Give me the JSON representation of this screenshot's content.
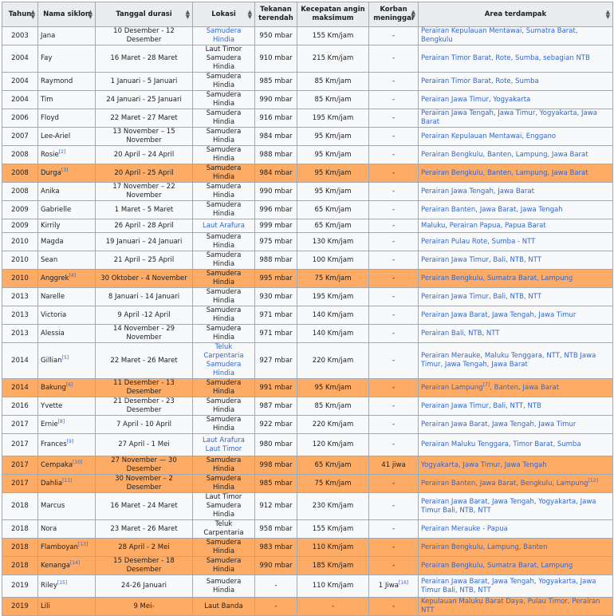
{
  "headers": {
    "tahun": "Tahun",
    "nama": "Nama siklon",
    "tanggal": "Tanggal durasi",
    "lokasi": "Lokasi",
    "tekanan": "Tekanan terendah",
    "kecepatan": "Kecepatan angin maksimum",
    "korban": "Korban meninggal",
    "area": "Area terdampak"
  },
  "sort_icon": "sort-icon",
  "colors": {
    "highlight": "#fdab65",
    "link": "#3366cc",
    "header_bg": "#eaecf0",
    "row_bg": "#f8f9fa",
    "border": "#a2a9b1"
  },
  "rows": [
    {
      "year": "2003",
      "name": "Jana",
      "sup": "",
      "date": "10 Desember - 12 Desember",
      "loc": [
        "Samudera Hindia"
      ],
      "loc_link": true,
      "pressure": "950 mbar",
      "wind": "155 Km/jam",
      "deaths": "-",
      "deaths_sup": "",
      "area": "Perairan Kepulauan Mentawai, Sumatra Barat, Bengkulu",
      "area_sup": "",
      "hl": false
    },
    {
      "year": "2004",
      "name": "Fay",
      "sup": "",
      "date": "16 Maret - 28 Maret",
      "loc": [
        "Laut Timor",
        "Samudera Hindia"
      ],
      "loc_link": false,
      "pressure": "910 mbar",
      "wind": "215 Km/jam",
      "deaths": "-",
      "deaths_sup": "",
      "area": "Perairan Timor Barat, Rote, Sumba, sebagian NTB",
      "area_sup": "",
      "hl": false
    },
    {
      "year": "2004",
      "name": "Raymond",
      "sup": "",
      "date": "1 Januari - 5 Januari",
      "loc": [
        "Samudera Hindia"
      ],
      "loc_link": false,
      "pressure": "985 mbar",
      "wind": "85 Km/jam",
      "deaths": "-",
      "deaths_sup": "",
      "area": "Perairan Timor Barat, Rote, Sumba",
      "area_sup": "",
      "hl": false
    },
    {
      "year": "2004",
      "name": "Tim",
      "sup": "",
      "date": "24 Januari - 25 Januari",
      "loc": [
        "Samudera Hindia"
      ],
      "loc_link": false,
      "pressure": "990 mbar",
      "wind": "85 Km/jam",
      "deaths": "-",
      "deaths_sup": "",
      "area": "Perairan Jawa Timur, Yogyakarta",
      "area_sup": "",
      "hl": false
    },
    {
      "year": "2006",
      "name": "Floyd",
      "sup": "",
      "date": "22 Maret - 27 Maret",
      "loc": [
        "Samudera Hindia"
      ],
      "loc_link": false,
      "pressure": "916 mbar",
      "wind": "195 Km/jam",
      "deaths": "-",
      "deaths_sup": "",
      "area": "Perairan Jawa Tengah, Jawa Timur, Yogyakarta, Jawa Barat",
      "area_sup": "",
      "hl": false
    },
    {
      "year": "2007",
      "name": "Lee-Ariel",
      "sup": "",
      "date": "13 November – 15 November",
      "loc": [
        "Samudera Hindia"
      ],
      "loc_link": false,
      "pressure": "984 mbar",
      "wind": "95 Km/jam",
      "deaths": "-",
      "deaths_sup": "",
      "area": "Perairan Kepulauan Mentawai, Enggano",
      "area_sup": "",
      "hl": false
    },
    {
      "year": "2008",
      "name": "Rosie",
      "sup": "[2]",
      "date": "20 April – 24 April",
      "loc": [
        "Samudera Hindia"
      ],
      "loc_link": false,
      "pressure": "988 mbar",
      "wind": "95 Km/jam",
      "deaths": "-",
      "deaths_sup": "",
      "area": "Perairan Bengkulu, Banten, Lampung, Jawa Barat",
      "area_sup": "",
      "hl": false
    },
    {
      "year": "2008",
      "name": "Durga",
      "sup": "[3]",
      "date": "20 April - 25 April",
      "loc": [
        "Samudera Hindia"
      ],
      "loc_link": false,
      "pressure": "984 mbar",
      "wind": "95 Km/jam",
      "deaths": "-",
      "deaths_sup": "",
      "area": "Perairan Bengkulu, Banten, Lampung, Jawa Barat",
      "area_sup": "",
      "hl": true
    },
    {
      "year": "2008",
      "name": "Anika",
      "sup": "",
      "date": "17 November – 22 November",
      "loc": [
        "Samudera Hindia"
      ],
      "loc_link": false,
      "pressure": "990 mbar",
      "wind": "95 Km/jam",
      "deaths": "-",
      "deaths_sup": "",
      "area": "Perairan Jawa Tengah, Jawa Barat",
      "area_sup": "",
      "hl": false
    },
    {
      "year": "2009",
      "name": "Gabrielle",
      "sup": "",
      "date": "1 Maret - 5 Maret",
      "loc": [
        "Samudera Hindia"
      ],
      "loc_link": false,
      "pressure": "996 mbar",
      "wind": "65 Km/jam",
      "deaths": "-",
      "deaths_sup": "",
      "area": "Perairan Banten, Jawa Barat, Jawa Tengah",
      "area_sup": "",
      "hl": false
    },
    {
      "year": "2009",
      "name": "Kirrily",
      "sup": "",
      "date": "26 April - 28 April",
      "loc": [
        "Laut Arafura"
      ],
      "loc_link": true,
      "pressure": "999 mbar",
      "wind": "65 Km/jam",
      "deaths": "-",
      "deaths_sup": "",
      "area": "Maluku, Perairan Papua, Papua Barat",
      "area_sup": "",
      "hl": false
    },
    {
      "year": "2010",
      "name": "Magda",
      "sup": "",
      "date": "19 Januari – 24 Januari",
      "loc": [
        "Samudera Hindia"
      ],
      "loc_link": false,
      "pressure": "975 mbar",
      "wind": "130 Km/jam",
      "deaths": "-",
      "deaths_sup": "",
      "area": "Perairan Pulau Rote, Sumba - NTT",
      "area_sup": "",
      "hl": false
    },
    {
      "year": "2010",
      "name": "Sean",
      "sup": "",
      "date": "21 April – 25 April",
      "loc": [
        "Samudera Hindia"
      ],
      "loc_link": false,
      "pressure": "988 mbar",
      "wind": "100 Km/jam",
      "deaths": "-",
      "deaths_sup": "",
      "area": "Perairan Jawa Timur, Bali, NTB, NTT",
      "area_sup": "",
      "hl": false
    },
    {
      "year": "2010",
      "name": "Anggrek",
      "sup": "[4]",
      "date": "30 Oktober - 4 November",
      "loc": [
        "Samudera Hindia"
      ],
      "loc_link": false,
      "pressure": "995 mbar",
      "wind": "75 Km/jam",
      "deaths": "-",
      "deaths_sup": "",
      "area": "Perairan Bengkulu, Sumatra Barat, Lampung",
      "area_sup": "",
      "hl": true
    },
    {
      "year": "2013",
      "name": "Narelle",
      "sup": "",
      "date": "8 Januari - 14 Januari",
      "loc": [
        "Samudera Hindia"
      ],
      "loc_link": false,
      "pressure": "930 mbar",
      "wind": "195 Km/jam",
      "deaths": "-",
      "deaths_sup": "",
      "area": "Perairan Jawa Timur, Bali, NTB, NTT",
      "area_sup": "",
      "hl": false
    },
    {
      "year": "2013",
      "name": "Victoria",
      "sup": "",
      "date": "9 April -12 April",
      "loc": [
        "Samudera Hindia"
      ],
      "loc_link": false,
      "pressure": "971 mbar",
      "wind": "140 Km/jam",
      "deaths": "-",
      "deaths_sup": "",
      "area": "Perairan Jawa Barat, Jawa Tengah, Jawa Timur",
      "area_sup": "",
      "hl": false
    },
    {
      "year": "2013",
      "name": "Alessia",
      "sup": "",
      "date": "14 November - 29 November",
      "loc": [
        "Samudera Hindia"
      ],
      "loc_link": false,
      "pressure": "971 mbar",
      "wind": "140 Km/jam",
      "deaths": "-",
      "deaths_sup": "",
      "area": "Perairan Bali, NTB, NTT",
      "area_sup": "",
      "hl": false
    },
    {
      "year": "2014",
      "name": "Gillian",
      "sup": "[5]",
      "date": "22 Maret - 26 Maret",
      "loc": [
        "Teluk Carpentaria",
        "Samudera Hindia"
      ],
      "loc_link": true,
      "pressure": "927 mbar",
      "wind": "220 Km/jam",
      "deaths": "-",
      "deaths_sup": "",
      "area": "Perairan Merauke, Maluku Tenggara, NTT, NTB Jawa Timur, Jawa Tengah, Jawa Barat",
      "area_sup": "",
      "hl": false
    },
    {
      "year": "2014",
      "name": "Bakung",
      "sup": "[6]",
      "date": "11 Desember - 13 Desember",
      "loc": [
        "Samudera Hindia"
      ],
      "loc_link": false,
      "pressure": "991 mbar",
      "wind": "95 Km/jam",
      "deaths": "-",
      "deaths_sup": "",
      "area": "Perairan Lampung",
      "area_sup": "[7]",
      "area_tail": ", Banten, Jawa Barat",
      "hl": true
    },
    {
      "year": "2016",
      "name": "Yvette",
      "sup": "",
      "date": "21 Desember - 23 Desember",
      "loc": [
        "Samudera Hindia"
      ],
      "loc_link": false,
      "pressure": "987 mbar",
      "wind": "85 Km/jam",
      "deaths": "-",
      "deaths_sup": "",
      "area": "Perairan Jawa Timur, Bali, NTT, NTB",
      "area_sup": "",
      "hl": false
    },
    {
      "year": "2017",
      "name": "Ernie",
      "sup": "[8]",
      "date": "7 April - 10 April",
      "loc": [
        "Samudera Hindia"
      ],
      "loc_link": false,
      "pressure": "922 mbar",
      "wind": "220 Km/jam",
      "deaths": "-",
      "deaths_sup": "",
      "area": "Perairan Jawa Barat, Jawa Tengah, Jawa Timur",
      "area_sup": "",
      "hl": false
    },
    {
      "year": "2017",
      "name": "Frances",
      "sup": "[9]",
      "date": "27 April - 1 Mei",
      "loc": [
        "Laut Arafura",
        "Laut Timor"
      ],
      "loc_link": true,
      "pressure": "980 mbar",
      "wind": "120 Km/jam",
      "deaths": "-",
      "deaths_sup": "",
      "area": "Perairan Maluku Tenggara, Timor Barat, Sumba",
      "area_sup": "",
      "hl": false
    },
    {
      "year": "2017",
      "name": "Cempaka",
      "sup": "[10]",
      "date": "27 November — 30 Desember",
      "loc": [
        "Samudera Hindia"
      ],
      "loc_link": false,
      "pressure": "998 mbar",
      "wind": "65 Km/jam",
      "deaths": "41 jiwa",
      "deaths_sup": "",
      "area": "Yogyakarta, Jawa Timur, Jawa Tengah",
      "area_sup": "",
      "hl": true
    },
    {
      "year": "2017",
      "name": "Dahlia",
      "sup": "[11]",
      "date": "30 November – 2 Desember",
      "loc": [
        "Samudera Hindia"
      ],
      "loc_link": false,
      "pressure": "985 mbar",
      "wind": "75 Km/jam",
      "deaths": "-",
      "deaths_sup": "",
      "area": "Perairan Banten, Jawa Barat, Bengkulu, Lampung",
      "area_sup": "[12]",
      "hl": true
    },
    {
      "year": "2018",
      "name": "Marcus",
      "sup": "",
      "date": "16 Maret - 24 Maret",
      "loc": [
        "Laut Timor",
        "Samudera Hindia"
      ],
      "loc_link": false,
      "pressure": "912 mbar",
      "wind": "230 Km/jam",
      "deaths": "-",
      "deaths_sup": "",
      "area": "Perairan Jawa Barat, Jawa Tengah, Yogyakarta, Jawa Timur Bali, NTB, NTT",
      "area_sup": "",
      "hl": false
    },
    {
      "year": "2018",
      "name": "Nora",
      "sup": "",
      "date": "23 Maret - 26 Maret",
      "loc": [
        "Teluk Carpentaria"
      ],
      "loc_link": false,
      "pressure": "958 mbar",
      "wind": "155 Km/jam",
      "deaths": "-",
      "deaths_sup": "",
      "area": "Perairan Merauke - Papua",
      "area_sup": "",
      "hl": false
    },
    {
      "year": "2018",
      "name": "Flamboyan",
      "sup": "[13]",
      "date": "28 April - 2 Mei",
      "loc": [
        "Samudera Hindia"
      ],
      "loc_link": false,
      "pressure": "983 mbar",
      "wind": "110 Km/jam",
      "deaths": "-",
      "deaths_sup": "",
      "area": "Perairan Bengkulu, Lampung, Banten",
      "area_sup": "",
      "hl": true
    },
    {
      "year": "2018",
      "name": "Kenanga",
      "sup": "[14]",
      "date": "15 Desember - 18 Desember",
      "loc": [
        "Samudera Hindia"
      ],
      "loc_link": false,
      "pressure": "990 mbar",
      "wind": "185 Km/jam",
      "deaths": "-",
      "deaths_sup": "",
      "area": "Perairan Bengkulu, Sumatra Barat, Lampung",
      "area_sup": "",
      "hl": true
    },
    {
      "year": "2019",
      "name": "Riley",
      "sup": "[15]",
      "date": "24-26 Januari",
      "loc": [
        "Samudera Hindia"
      ],
      "loc_link": false,
      "pressure": "-",
      "wind": "110 Km/jam",
      "deaths": "1 Jiwa",
      "deaths_sup": "[16]",
      "area": "Perairan Jawa Barat, Jawa Tengah, Yogyakarta, Jawa Timur Bali, NTB, NTT",
      "area_sup": "",
      "hl": false
    },
    {
      "year": "2019",
      "name": "Lili",
      "sup": "",
      "date": "9 Mei-",
      "loc": [
        "Laut Banda"
      ],
      "loc_link": false,
      "pressure": "-",
      "wind": "-",
      "deaths": "-",
      "deaths_sup": "",
      "area": "Kepulauan Maluku Barat Daya, Pulau Timor, Perairan NTT",
      "area_sup": "",
      "hl": true
    }
  ]
}
